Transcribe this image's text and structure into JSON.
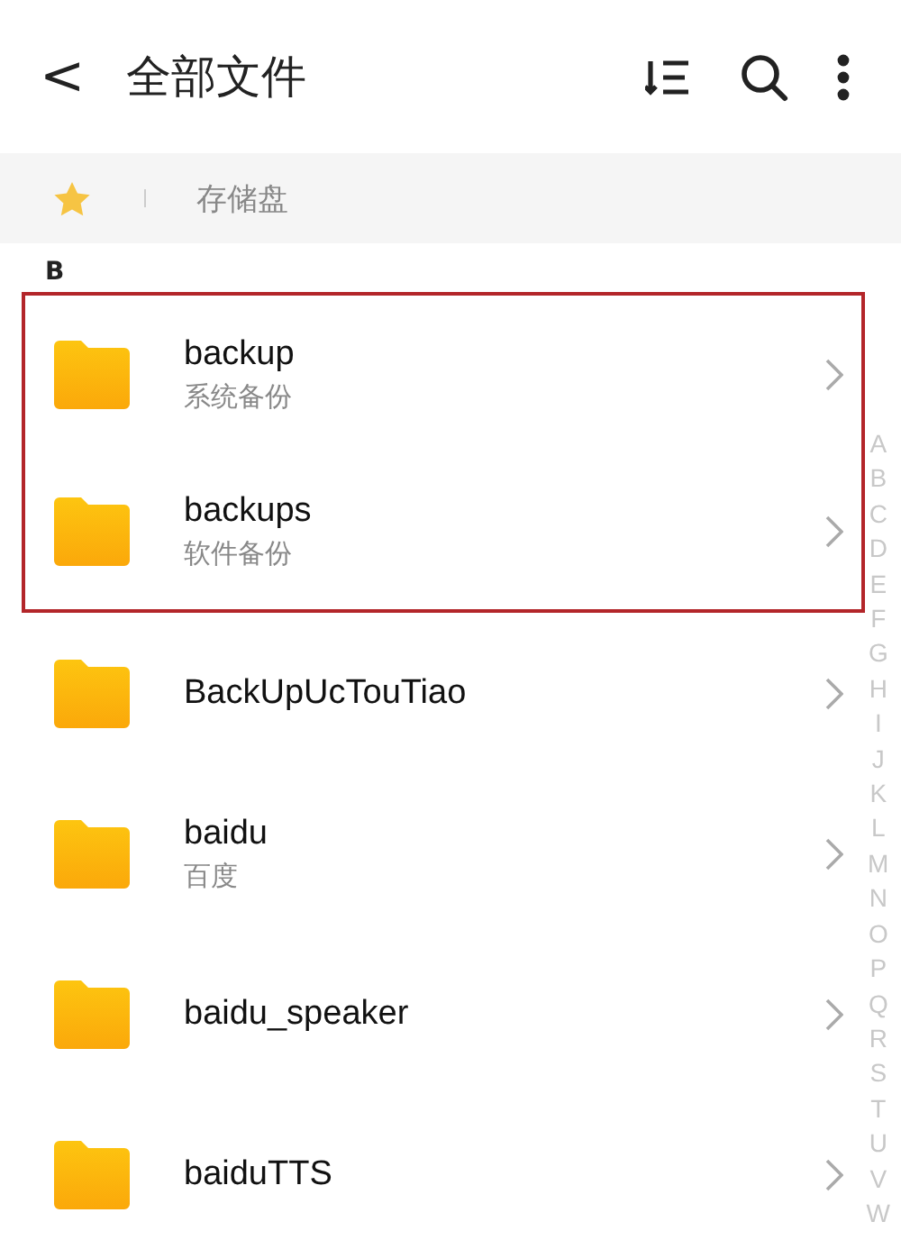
{
  "header": {
    "back": "<",
    "title": "全部文件"
  },
  "breadcrumb": {
    "path": "存储盘"
  },
  "section": "B",
  "files": [
    {
      "name": "backup",
      "subtitle": "系统备份",
      "highlighted": true
    },
    {
      "name": "backups",
      "subtitle": "软件备份",
      "highlighted": true
    },
    {
      "name": "BackUpUcTouTiao",
      "highlighted": false
    },
    {
      "name": "baidu",
      "subtitle": "百度",
      "highlighted": false
    },
    {
      "name": "baidu_speaker",
      "highlighted": false
    },
    {
      "name": "baiduTTS",
      "highlighted": false
    }
  ],
  "index": [
    "A",
    "B",
    "C",
    "D",
    "E",
    "F",
    "G",
    "H",
    "I",
    "J",
    "K",
    "L",
    "M",
    "N",
    "O",
    "P",
    "Q",
    "R",
    "S",
    "T",
    "U",
    "V",
    "W"
  ]
}
